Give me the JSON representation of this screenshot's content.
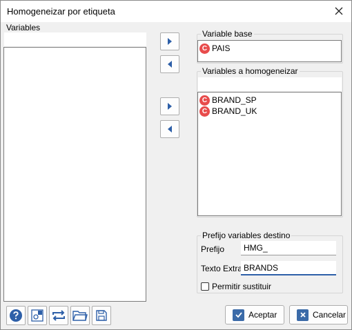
{
  "window": {
    "title": "Homogeneizar por etiqueta"
  },
  "variables_panel": {
    "label": "Variables"
  },
  "variable_base": {
    "label": "Variable base",
    "item": {
      "type_icon": "C",
      "name": "PAIS"
    }
  },
  "variables_homogeneizar": {
    "label": "Variables a homogeneizar",
    "items": [
      {
        "type_icon": "C",
        "name": "BRAND_SP"
      },
      {
        "type_icon": "C",
        "name": "BRAND_UK"
      }
    ]
  },
  "prefix_group": {
    "label": "Prefijo variables destino",
    "prefijo_label": "Prefijo",
    "prefijo_value": "HMG_",
    "texto_extra_label": "Texto Extra",
    "texto_extra_value": "BRANDS",
    "permitir_label": "Permitir sustituir",
    "permitir_checked": false
  },
  "buttons": {
    "aceptar_label": "Aceptar",
    "cancelar_label": "Cancelar"
  },
  "toolbar_icons": [
    "help-icon",
    "settings-icon",
    "refresh-icon",
    "open-folder-icon",
    "save-icon"
  ],
  "colors": {
    "accent": "#2d5fa8",
    "type_icon": "#e84c4c"
  }
}
